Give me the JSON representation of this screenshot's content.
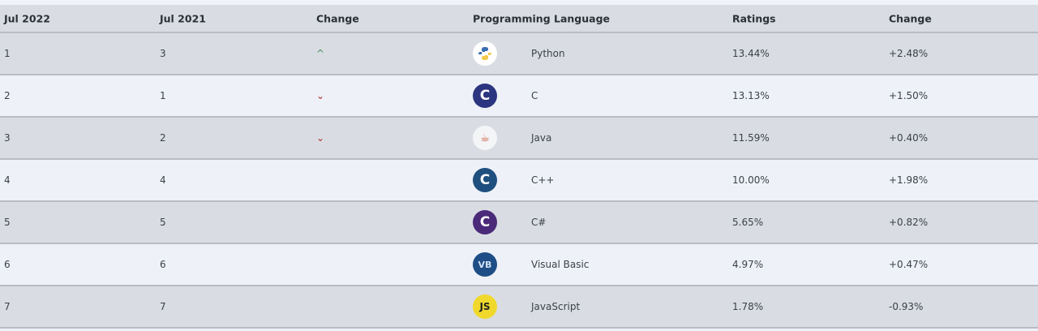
{
  "headers": [
    "Jul 2022",
    "Jul 2021",
    "Change",
    "Programming Language",
    "Ratings",
    "Change"
  ],
  "rows": [
    {
      "rank": "1",
      "prev": "3",
      "trend": "up",
      "language": "Python",
      "icon": "python-logo-icon",
      "ratings": "13.44%",
      "change": "+2.48%"
    },
    {
      "rank": "2",
      "prev": "1",
      "trend": "down",
      "language": "C",
      "icon": "c-logo-icon",
      "ratings": "13.13%",
      "change": "+1.50%"
    },
    {
      "rank": "3",
      "prev": "2",
      "trend": "down",
      "language": "Java",
      "icon": "java-logo-icon",
      "ratings": "11.59%",
      "change": "+0.40%"
    },
    {
      "rank": "4",
      "prev": "4",
      "trend": "",
      "language": "C++",
      "icon": "cpp-logo-icon",
      "ratings": "10.00%",
      "change": "+1.98%"
    },
    {
      "rank": "5",
      "prev": "5",
      "trend": "",
      "language": "C#",
      "icon": "csharp-logo-icon",
      "ratings": "5.65%",
      "change": "+0.82%"
    },
    {
      "rank": "6",
      "prev": "6",
      "trend": "",
      "language": "Visual Basic",
      "icon": "visual-basic-logo-icon",
      "ratings": "4.97%",
      "change": "+0.47%"
    },
    {
      "rank": "7",
      "prev": "7",
      "trend": "",
      "language": "JavaScript",
      "icon": "javascript-logo-icon",
      "ratings": "1.78%",
      "change": "-0.93%"
    }
  ],
  "icon_labels": {
    "vb": "VB",
    "js": "JS"
  },
  "colors": {
    "up": "#4a8a5a",
    "down": "#b02a2a"
  }
}
